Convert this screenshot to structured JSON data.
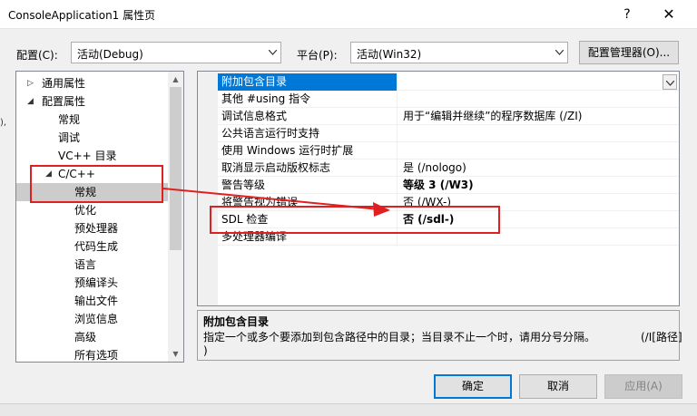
{
  "window": {
    "title": "ConsoleApplication1 属性页",
    "help_glyph": "?",
    "close_glyph": "✕"
  },
  "config": {
    "label": "配置(C):",
    "value": "活动(Debug)"
  },
  "platform": {
    "label": "平台(P):",
    "value": "活动(Win32)"
  },
  "config_manager_label": "配置管理器(O)...",
  "tree": {
    "items": [
      {
        "label": "通用属性",
        "expander": "▷"
      },
      {
        "label": "配置属性",
        "expander": "◢"
      },
      {
        "label": "常规"
      },
      {
        "label": "调试"
      },
      {
        "label": "VC++ 目录"
      },
      {
        "label": "C/C++",
        "expander": "◢"
      },
      {
        "label": "常规"
      },
      {
        "label": "优化"
      },
      {
        "label": "预处理器"
      },
      {
        "label": "代码生成"
      },
      {
        "label": "语言"
      },
      {
        "label": "预编译头"
      },
      {
        "label": "输出文件"
      },
      {
        "label": "浏览信息"
      },
      {
        "label": "高级"
      },
      {
        "label": "所有选项"
      }
    ]
  },
  "properties": [
    {
      "name": "附加包含目录",
      "value": ""
    },
    {
      "name": "其他 #using 指令",
      "value": ""
    },
    {
      "name": "调试信息格式",
      "value": "用于“编辑并继续”的程序数据库 (/ZI)"
    },
    {
      "name": "公共语言运行时支持",
      "value": ""
    },
    {
      "name": "使用 Windows 运行时扩展",
      "value": ""
    },
    {
      "name": "取消显示启动版权标志",
      "value": "是 (/nologo)"
    },
    {
      "name": "警告等级",
      "value": "等级 3 (/W3)"
    },
    {
      "name": "将警告视为错误",
      "value": "否 (/WX-)"
    },
    {
      "name": "SDL 检查",
      "value": "否 (/sdl-)"
    },
    {
      "name": "多处理器编译",
      "value": ""
    }
  ],
  "description": {
    "title": "附加包含目录",
    "text": "指定一个或多个要添加到包含路径中的目录；当目录不止一个时，请用分号分隔。",
    "text_tail": "(/I[路径]",
    "text_line2": ")"
  },
  "buttons": {
    "ok": "确定",
    "cancel": "取消",
    "apply": "应用(A)"
  },
  "left_edge_glyph": "),",
  "colors": {
    "selection": "#0078d7",
    "annotation": "#e02020",
    "tree_selection": "#cccccc"
  }
}
